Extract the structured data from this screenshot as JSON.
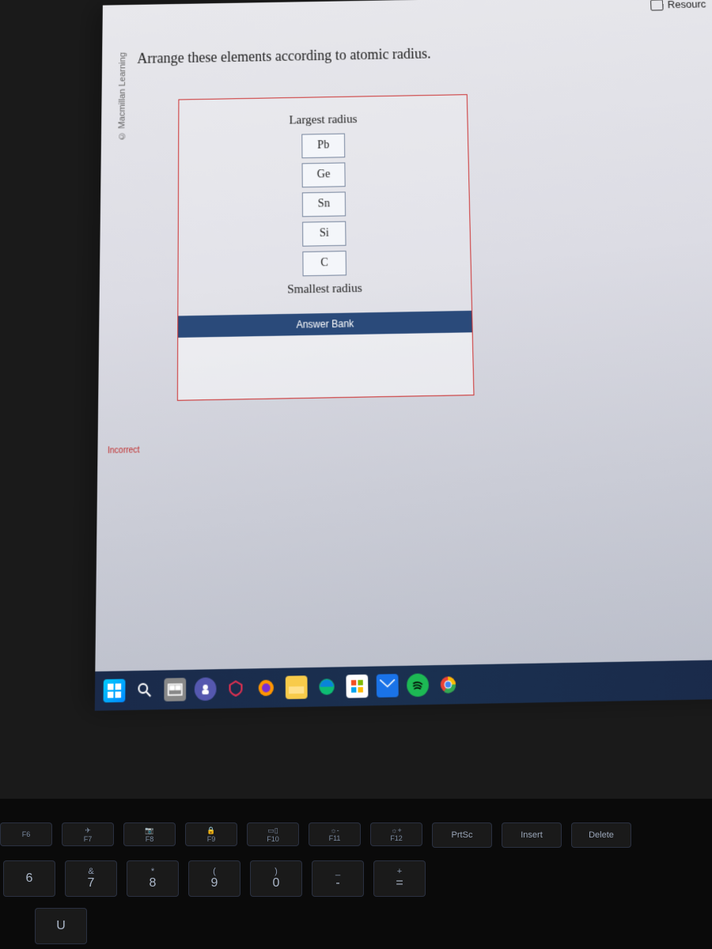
{
  "topbar": {
    "resources_label": "Resourc"
  },
  "copyright": "© Macmillan Learning",
  "question_text": "Arrange these elements according to atomic radius.",
  "ranking": {
    "top_label": "Largest radius",
    "bottom_label": "Smallest radius",
    "slots": [
      "Pb",
      "Ge",
      "Sn",
      "Si",
      "C"
    ]
  },
  "answer_bank": {
    "header": "Answer Bank"
  },
  "status": {
    "incorrect": "Incorrect"
  },
  "taskbar_icons": [
    "start-icon",
    "search-icon",
    "task-view-icon",
    "teams-icon",
    "antivirus-icon",
    "firefox-icon",
    "file-explorer-icon",
    "edge-icon",
    "store-icon",
    "mail-icon",
    "spotify-icon",
    "chrome-icon"
  ],
  "keyboard": {
    "frow": [
      {
        "sub": "",
        "lbl": "F6"
      },
      {
        "sub": "✈",
        "lbl": "F7"
      },
      {
        "sub": "📷",
        "lbl": "F8"
      },
      {
        "sub": "🔒",
        "lbl": "F9"
      },
      {
        "sub": "▭▯",
        "lbl": "F10"
      },
      {
        "sub": "☼-",
        "lbl": "F11"
      },
      {
        "sub": "☼+",
        "lbl": "F12"
      },
      {
        "sub": "",
        "lbl": "PrtSc"
      },
      {
        "sub": "",
        "lbl": "Insert"
      },
      {
        "sub": "",
        "lbl": "Delete"
      }
    ],
    "nrow": [
      {
        "shift": "",
        "main": "6"
      },
      {
        "shift": "&",
        "main": "7"
      },
      {
        "shift": "*",
        "main": "8"
      },
      {
        "shift": "(",
        "main": "9"
      },
      {
        "shift": ")",
        "main": "0"
      },
      {
        "shift": "_",
        "main": "-"
      },
      {
        "shift": "+",
        "main": "="
      }
    ],
    "lrow": [
      {
        "main": "U"
      }
    ]
  }
}
